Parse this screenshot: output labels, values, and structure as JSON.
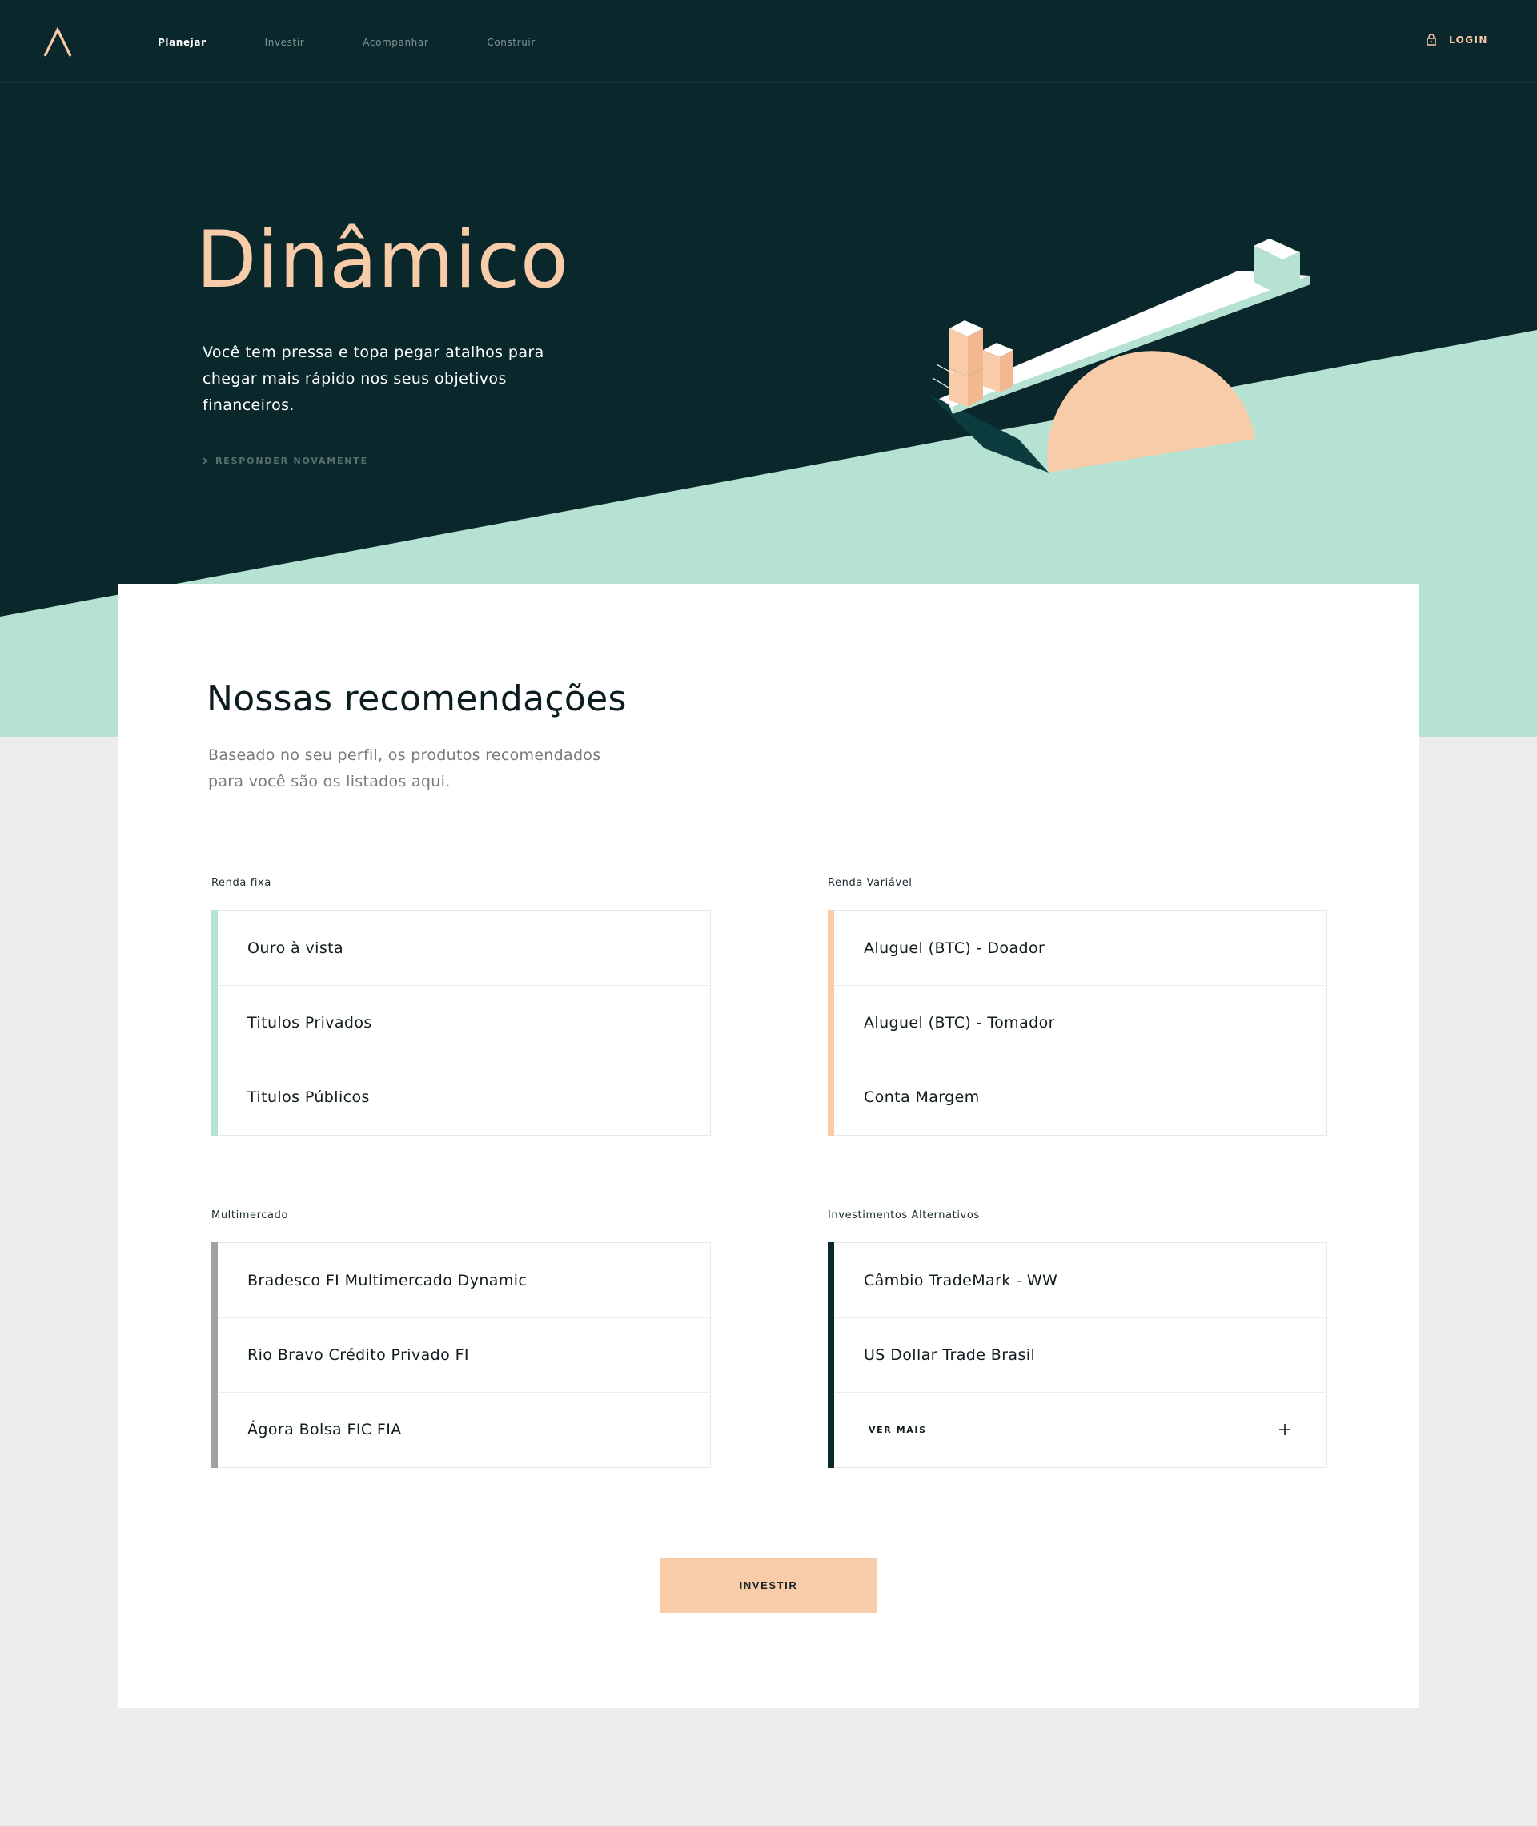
{
  "header": {
    "logo": "A-logo-icon",
    "nav": [
      {
        "label": "Planejar",
        "active": true
      },
      {
        "label": "Investir",
        "active": false
      },
      {
        "label": "Acompanhar",
        "active": false
      },
      {
        "label": "Construir",
        "active": false
      }
    ],
    "login_label": "LOGIN",
    "login_icon": "lock-icon"
  },
  "hero": {
    "title": "Dinâmico",
    "description": "Você tem pressa e topa pegar atalhos para chegar mais rápido nos seus objetivos financeiros.",
    "link_label": "RESPONDER NOVAMENTE",
    "link_icon": "chevron-right-icon"
  },
  "recommendations": {
    "title": "Nossas recomendações",
    "description": "Baseado no seu perfil, os produtos recomendados para você são os listados aqui.",
    "groups": [
      {
        "label": "Renda fixa",
        "color": "#b5e2d3",
        "items": [
          "Ouro à vista",
          "Titulos Privados",
          "Titulos Públicos"
        ]
      },
      {
        "label": "Renda Variável",
        "color": "#f8cca9",
        "items": [
          "Aluguel (BTC) - Doador",
          "Aluguel (BTC) - Tomador",
          "Conta Margem"
        ]
      },
      {
        "label": "Multimercado",
        "color": "#a0a09c",
        "items": [
          "Bradesco FI Multimercado Dynamic",
          "Rio Bravo Crédito Privado FI",
          "Ágora Bolsa FIC FIA"
        ]
      },
      {
        "label": "Investimentos Alternativos",
        "color": "#0b282c",
        "items": [
          "Câmbio TradeMark - WW",
          "US Dollar Trade Brasil"
        ],
        "more_label": "VER MAIS"
      }
    ],
    "invest_label": "INVESTIR"
  },
  "colors": {
    "dark": "#0a282b",
    "mint": "#b5e2d3",
    "peach": "#f8cca9",
    "background": "#ececec"
  }
}
